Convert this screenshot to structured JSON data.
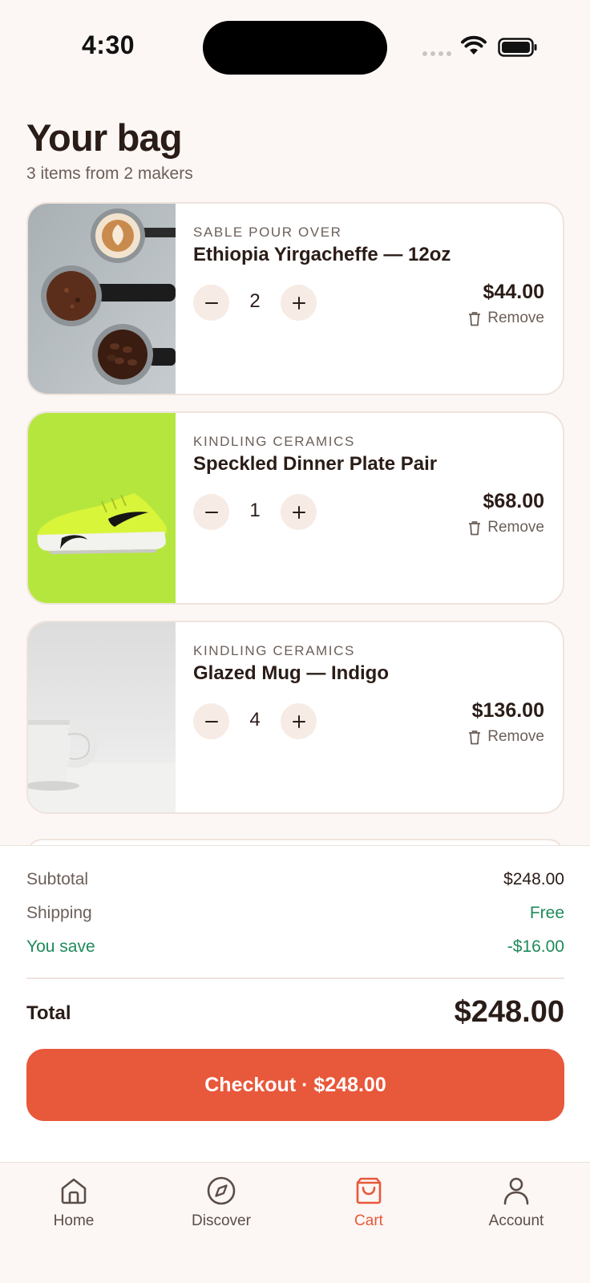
{
  "status_bar": {
    "time": "4:30"
  },
  "header": {
    "title": "Your bag",
    "subtitle": "3 items from 2 makers"
  },
  "cart": {
    "items": [
      {
        "maker": "SABLE POUR OVER",
        "name": "Ethiopia Yirgacheffe — 12oz",
        "quantity": "2",
        "price": "$44.00",
        "remove_label": "Remove",
        "image": "espresso-portafilters-photo"
      },
      {
        "maker": "KINDLING CERAMICS",
        "name": "Speckled Dinner Plate Pair",
        "quantity": "1",
        "price": "$68.00",
        "remove_label": "Remove",
        "image": "lime-sneaker-photo"
      },
      {
        "maker": "KINDLING CERAMICS",
        "name": "Glazed Mug — Indigo",
        "quantity": "4",
        "price": "$136.00",
        "remove_label": "Remove",
        "image": "white-mug-photo"
      }
    ]
  },
  "summary": {
    "subtotal_label": "Subtotal",
    "subtotal_value": "$248.00",
    "shipping_label": "Shipping",
    "shipping_value": "Free",
    "savings_label": "You save",
    "savings_value": "-$16.00",
    "total_label": "Total",
    "total_value": "$248.00",
    "checkout_label": "Checkout · $248.00"
  },
  "tab_bar": {
    "tabs": [
      {
        "label": "Home",
        "icon": "home-icon",
        "active": false
      },
      {
        "label": "Discover",
        "icon": "compass-icon",
        "active": false
      },
      {
        "label": "Cart",
        "icon": "bag-icon",
        "active": true
      },
      {
        "label": "Account",
        "icon": "person-icon",
        "active": false
      }
    ]
  },
  "colors": {
    "accent": "#e8583a",
    "savings_green": "#1f8a5b",
    "background": "#fcf7f4",
    "text_primary": "#2a1c17",
    "text_secondary": "#6c5f59"
  }
}
